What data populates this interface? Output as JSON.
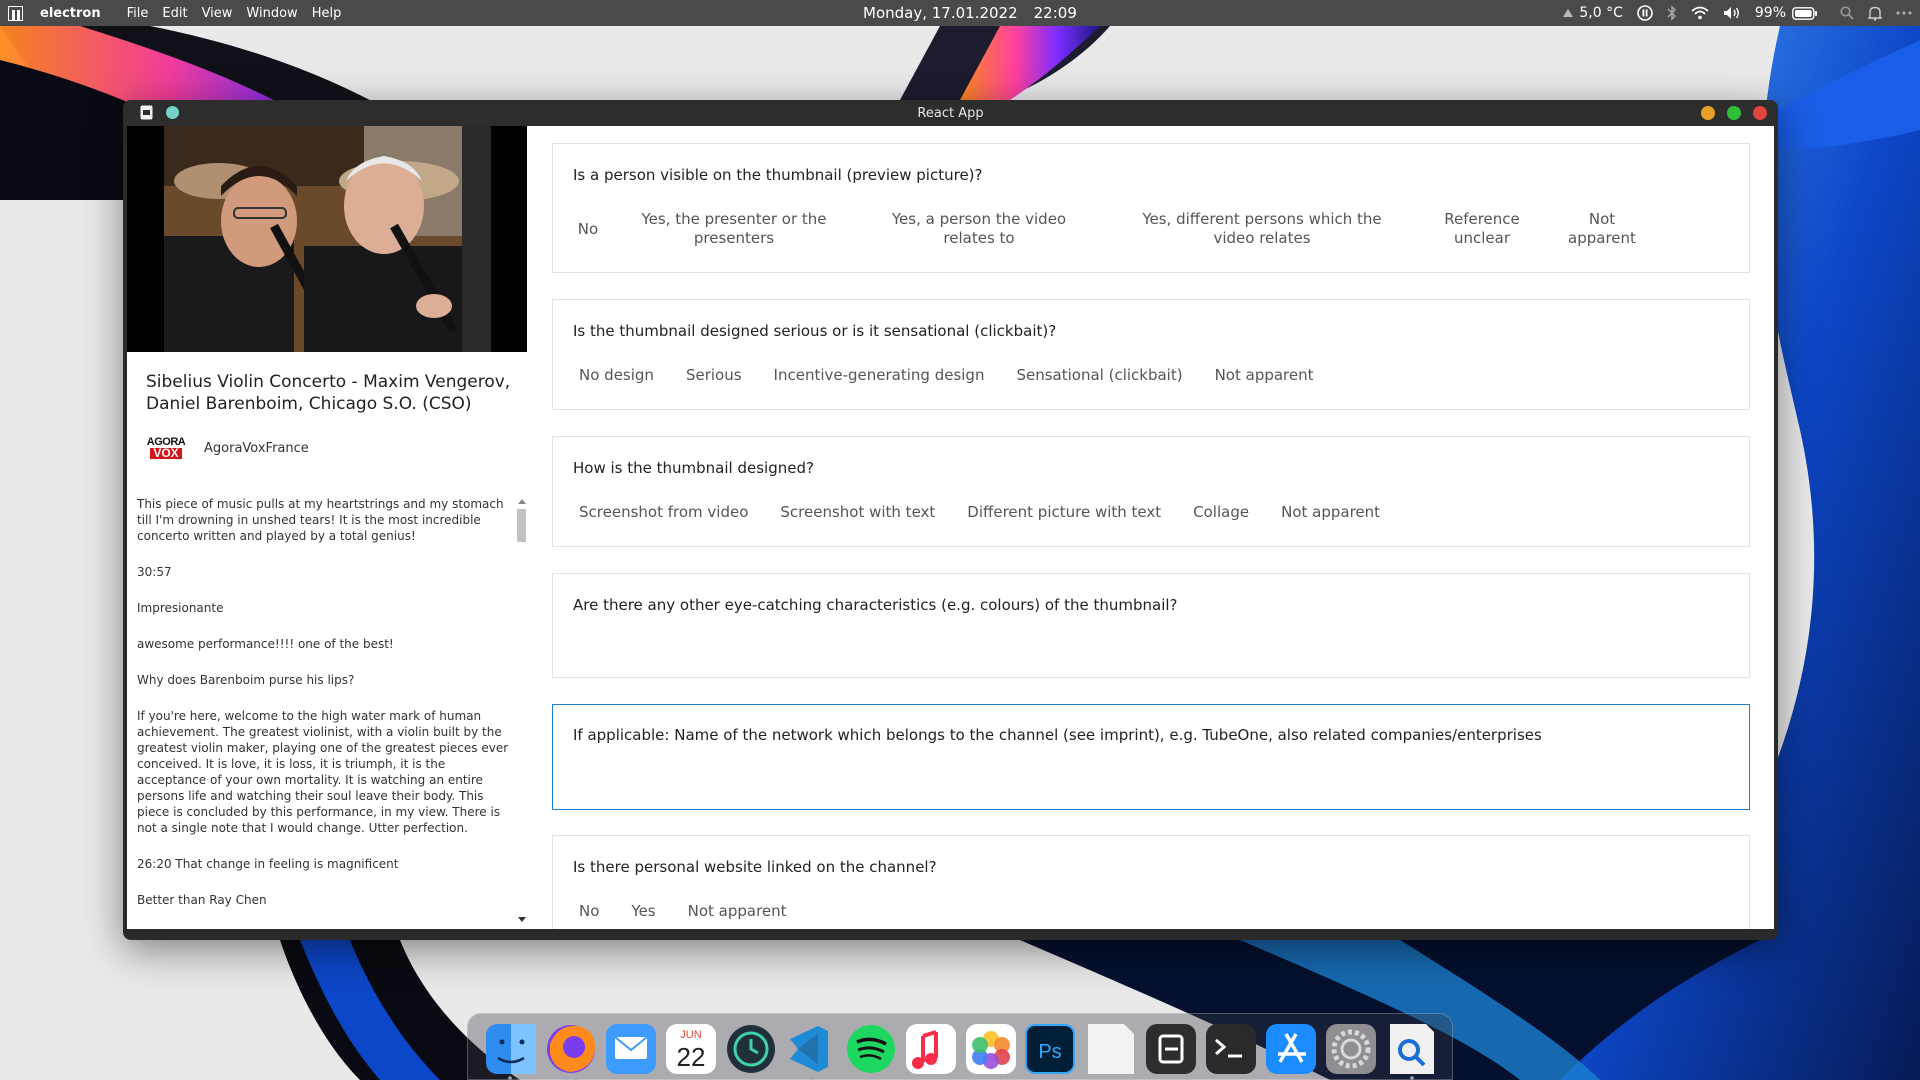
{
  "menubar": {
    "app_name": "electron",
    "menus": [
      "File",
      "Edit",
      "View",
      "Window",
      "Help"
    ],
    "date": "Monday, 17.01.2022",
    "time": "22:09",
    "weather": "5,0 °C",
    "battery": "99%"
  },
  "window": {
    "title": "React App"
  },
  "video": {
    "title": "Sibelius Violin Concerto - Maxim Vengerov, Daniel Barenboim, Chicago S.O. (CSO)",
    "channel_name": "AgoraVoxFrance",
    "channel_logo_top": "AGORA",
    "channel_logo_bottom": "VOX"
  },
  "comments": [
    "This piece of music pulls at my heartstrings and my stomach till I'm drowning in unshed tears! It is the most incredible concerto written and played by a total genius!",
    "30:57",
    "Impresionante",
    "awesome performance!!!! one of the best!",
    "Why does Barenboim purse his lips?",
    "If you're here, welcome to the high water mark of human achievement. The greatest violinist, with a violin built by the greatest violin maker, playing one of the greatest pieces ever conceived. It is love, it is loss, it is triumph, it is the acceptance of your own mortality. It is watching an entire persons life and watching their soul leave their body. This piece is concluded by this performance, in my view. There is not a single note that I would change. Utter perfection.",
    "26:20 That change in feeling is magnificent",
    "Better than Ray Chen"
  ],
  "questions": [
    {
      "text": "Is a person visible on the thumbnail (preview picture)?",
      "options": [
        "No",
        "Yes, the presenter or the presenters",
        "Yes, a person the video relates to",
        "Yes, different persons which the video relates",
        "Reference unclear",
        "Not apparent"
      ]
    },
    {
      "text": "Is the thumbnail designed serious or is it sensational (clickbait)?",
      "options": [
        "No design",
        "Serious",
        "Incentive-generating design",
        "Sensational (clickbait)",
        "Not apparent"
      ]
    },
    {
      "text": "How is the thumbnail designed?",
      "options": [
        "Screenshot from video",
        "Screenshot with text",
        "Different picture with text",
        "Collage",
        "Not apparent"
      ]
    },
    {
      "text": "Are there any other eye-catching characteristics (e.g. colours) of the thumbnail?",
      "options": []
    },
    {
      "text": "If applicable: Name of the network which belongs to the channel (see imprint), e.g. TubeOne, also related companies/enterprises",
      "options": []
    },
    {
      "text": "Is there personal website linked on the channel?",
      "options": [
        "No",
        "Yes",
        "Not apparent"
      ]
    }
  ],
  "dock": {
    "calendar_month": "JUN",
    "calendar_day": "22",
    "apps": [
      "finder-icon",
      "firefox-icon",
      "mail-icon",
      "calendar-icon",
      "time-machine-icon",
      "vscode-icon",
      "spotify-icon",
      "music-icon",
      "photos-icon",
      "photoshop-icon",
      "blank-file-icon",
      "electron-icon",
      "terminal-icon",
      "app-store-icon",
      "system-preferences-icon",
      "preview-icon"
    ],
    "ps_label": "Ps"
  },
  "colors": {
    "accent": "#1c7fd0",
    "menubar": "#4a4a4c",
    "window_chrome": "#2d2d2e",
    "close": "#e0443e",
    "minimize": "#e7a12b",
    "maximize": "#2fbe3a"
  }
}
